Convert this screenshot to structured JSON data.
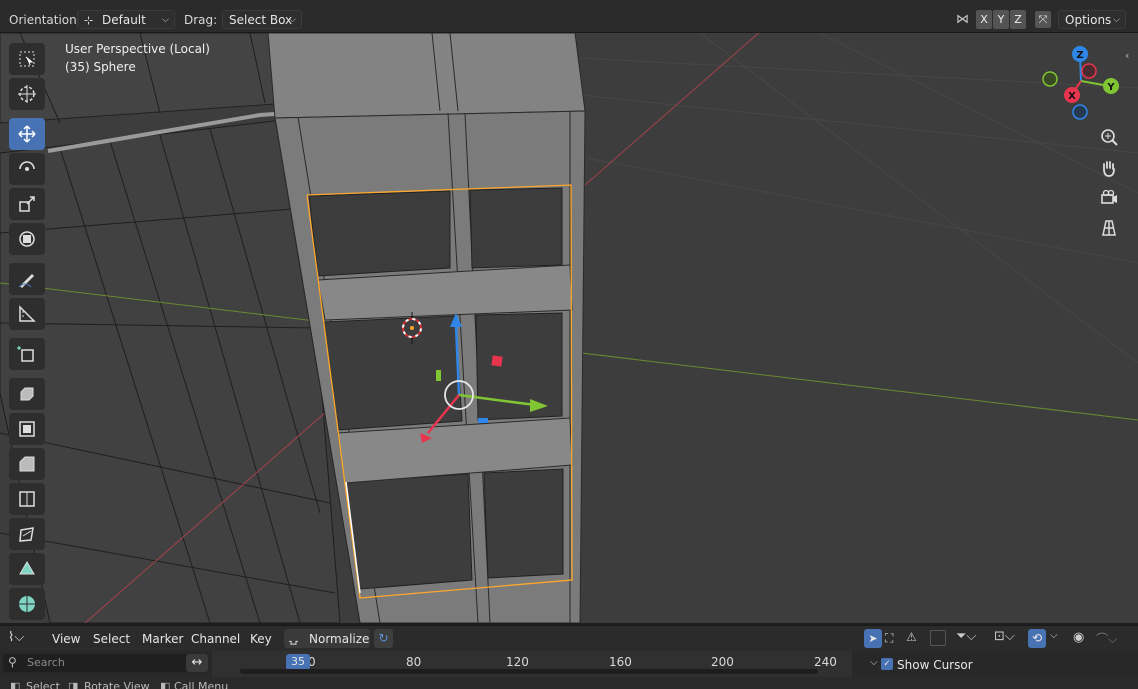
{
  "header": {
    "orientation_label": "Orientation:",
    "orientation_value": "Default",
    "drag_label": "Drag:",
    "drag_value": "Select Box",
    "axes": [
      "X",
      "Y",
      "Z"
    ],
    "options_label": "Options"
  },
  "viewport": {
    "perspective": "User Perspective (Local)",
    "object": "(35) Sphere",
    "gizmo_axes": {
      "x": "X",
      "y": "Y",
      "z": "Z"
    }
  },
  "toolbar_icons": [
    "select-box-icon",
    "cursor-icon",
    "move-icon",
    "rotate-icon",
    "scale-icon",
    "transform-icon",
    "annotate-icon",
    "measure-icon",
    "add-cube-icon",
    "extrude-icon",
    "inset-icon",
    "bevel-icon",
    "loop-cut-icon",
    "knife-icon",
    "poly-build-icon",
    "spin-icon"
  ],
  "active_tool": "move-icon",
  "timeline": {
    "menus": [
      "View",
      "Select",
      "Marker",
      "Channel",
      "Key"
    ],
    "normalize_label": "Normalize",
    "search_placeholder": "Search",
    "current_frame": "35",
    "ticks": [
      "0",
      "80",
      "120",
      "160",
      "200",
      "240"
    ],
    "show_cursor_label": "Show Cursor"
  },
  "status": {
    "select": "Select",
    "rotate": "Rotate View",
    "call_menu": "Call Menu"
  },
  "colors": {
    "accent": "#4772b3",
    "selection": "#ffa72b",
    "x_axis": "#e8354d",
    "y_axis": "#80c533",
    "z_axis": "#2e87e8"
  }
}
